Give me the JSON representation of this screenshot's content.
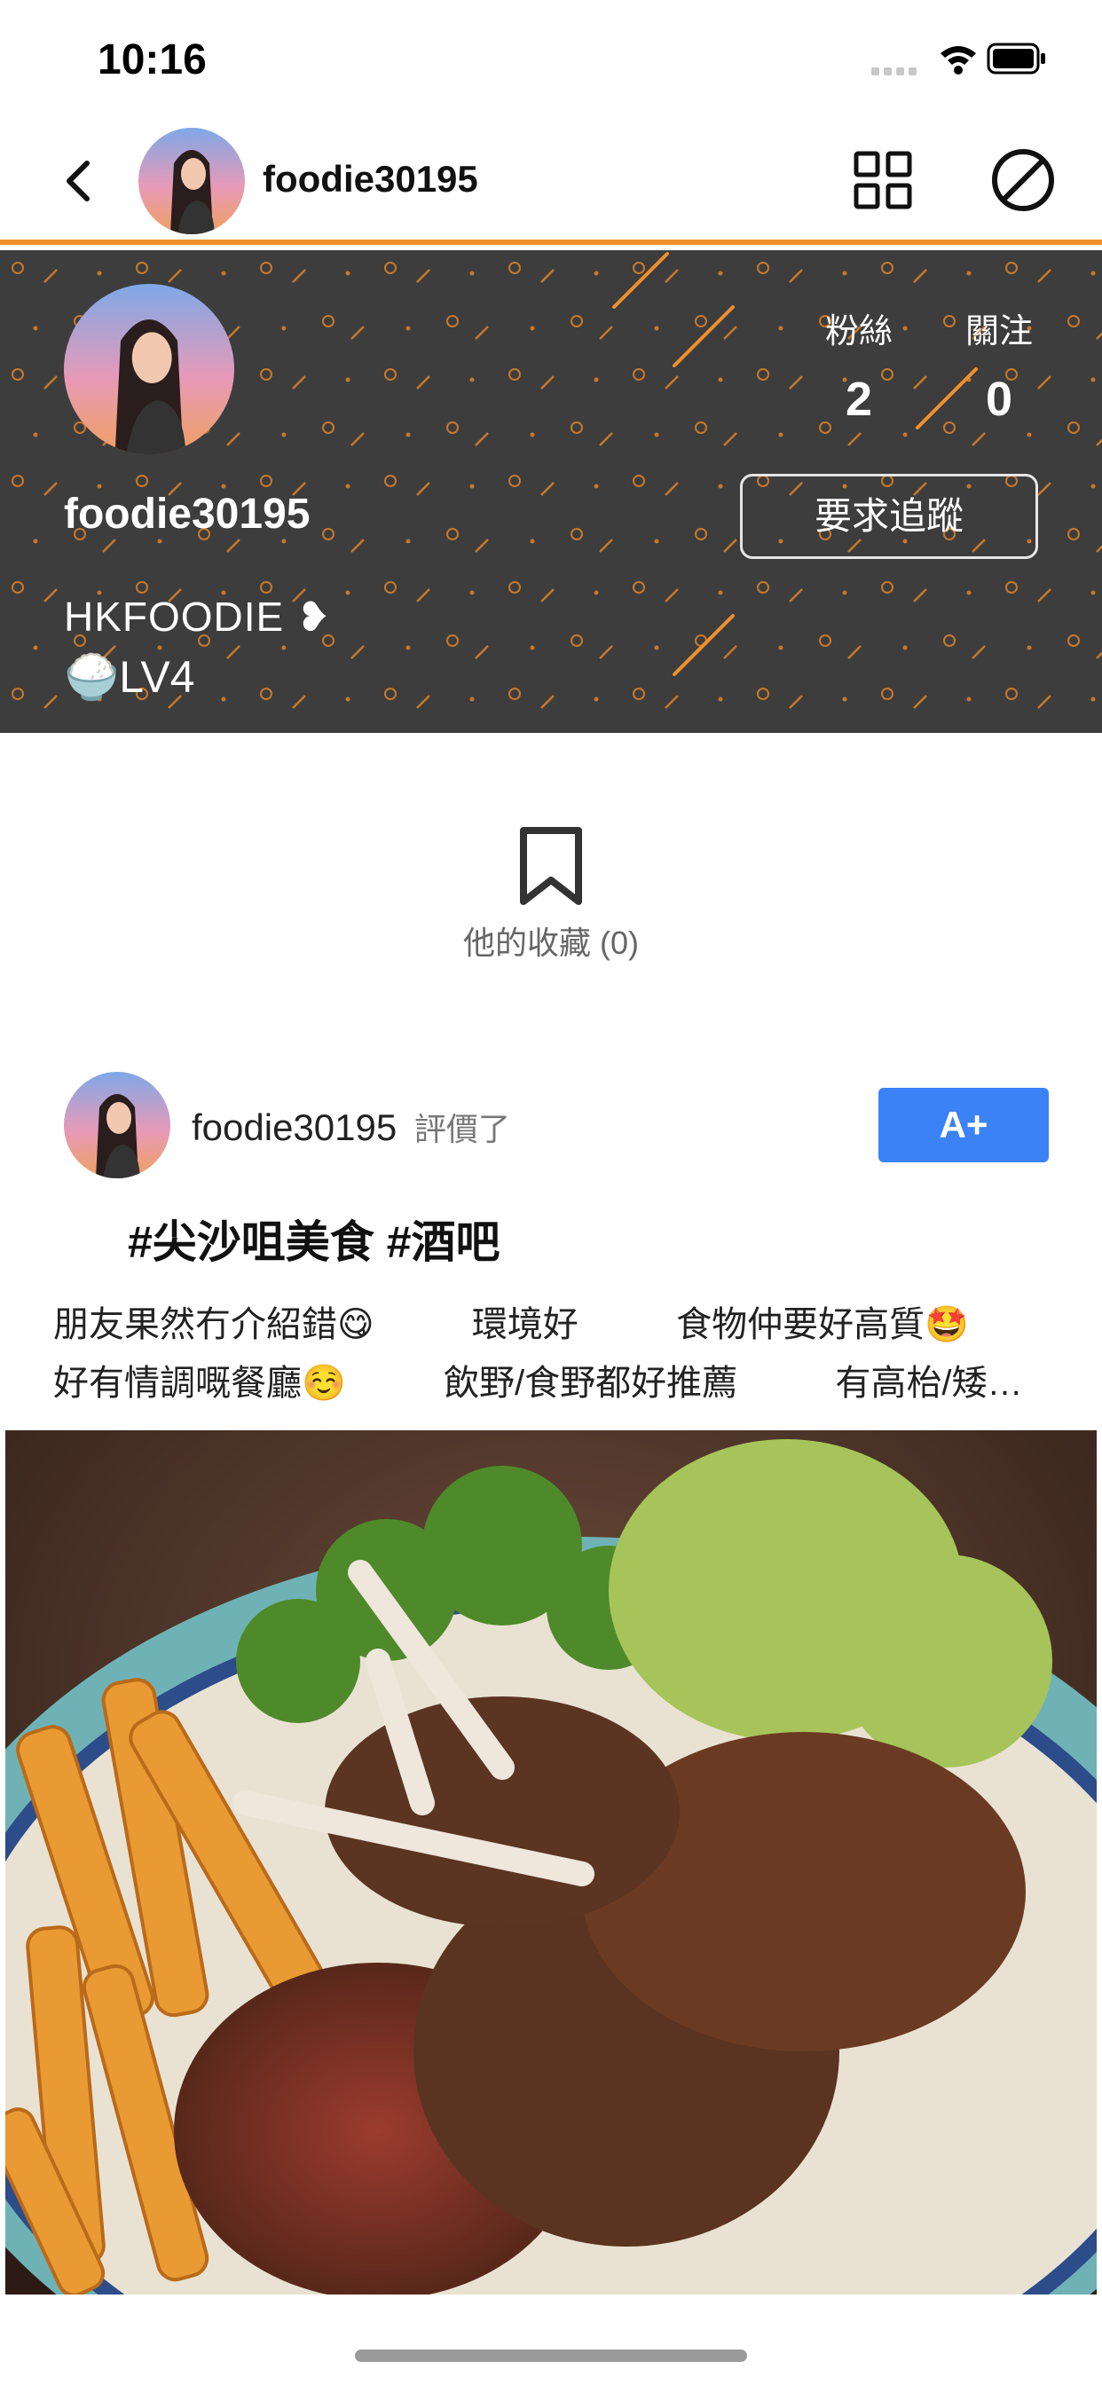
{
  "status_bar": {
    "time": "10:16"
  },
  "nav": {
    "username": "foodie30195"
  },
  "profile": {
    "username": "foodie30195",
    "bio_line1": "HKFOODIE ❥",
    "bio_line2": "🍚LV4",
    "stats": [
      {
        "label": "粉絲",
        "value": "2"
      },
      {
        "label": "關注",
        "value": "0"
      }
    ],
    "follow_button": "要求追蹤",
    "theme_colors": {
      "header_bg": "#3d3d3d",
      "accent": "#f0902c"
    }
  },
  "collections": {
    "label": "他的收藏 (0)"
  },
  "review": {
    "username": "foodie30195",
    "action": "評價了",
    "grade": "A+",
    "grade_color": "#3b82f6",
    "tags": "#尖沙咀美食 #酒吧",
    "text_line1": "朋友果然冇介紹錯😋 　 環境好 　 食物仲要好高質🤩",
    "text_line2": "好有情調嘅餐廳☺️ 　 飲野/食野都好推薦 　 有高枱/矮…"
  }
}
